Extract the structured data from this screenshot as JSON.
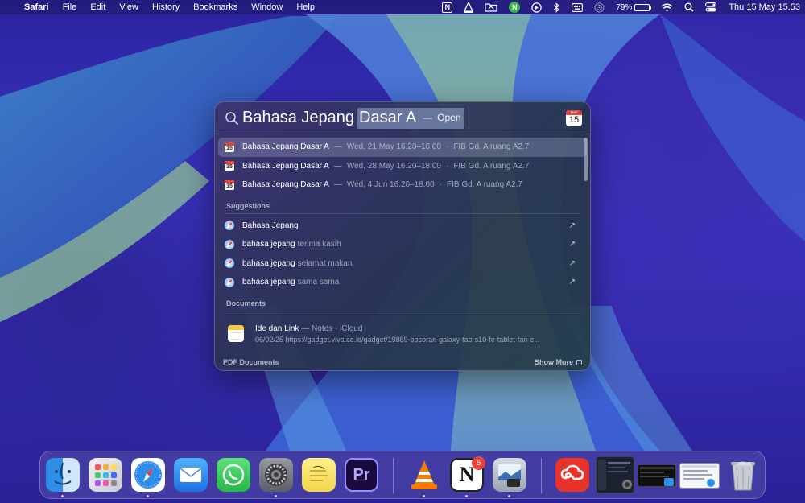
{
  "menubar": {
    "app_name": "Safari",
    "menus": [
      "File",
      "Edit",
      "View",
      "History",
      "Bookmarks",
      "Window",
      "Help"
    ],
    "status": {
      "notion_glyph": "N",
      "green_glyph": "N",
      "battery_percent": "79%",
      "battery_level": 0.79,
      "clock": "Thu 15 May  15.53"
    }
  },
  "spotlight": {
    "query_typed": "Bahasa Jepang",
    "query_completion": "Dasar A",
    "query_separator": "—",
    "query_action": "Open",
    "calendar_icon": {
      "month": "MAY",
      "day": "15"
    },
    "events": [
      {
        "title": "Bahasa Jepang Dasar A",
        "dash": "—",
        "when": "Wed, 21 May 16.20–18.00",
        "dot": "·",
        "where": "FIB Gd. A ruang A2.7",
        "day": "15"
      },
      {
        "title": "Bahasa Jepang Dasar A",
        "dash": "—",
        "when": "Wed, 28 May 16.20–18.00",
        "dot": "·",
        "where": "FIB Gd. A ruang A2.7",
        "day": "15"
      },
      {
        "title": "Bahasa Jepang Dasar A",
        "dash": "—",
        "when": "Wed, 4 Jun 16.20–18.00",
        "dot": "·",
        "where": "FIB Gd. A ruang A2.7",
        "day": "15"
      }
    ],
    "suggestions_header": "Suggestions",
    "suggestions": [
      {
        "bold": "Bahasa Jepang",
        "rest": ""
      },
      {
        "bold": "bahasa jepang",
        "rest": "terima kasih"
      },
      {
        "bold": "bahasa jepang",
        "rest": "selamat makan"
      },
      {
        "bold": "bahasa jepang",
        "rest": "sama sama"
      }
    ],
    "suggestion_arrow": "↗",
    "documents_header": "Documents",
    "document": {
      "title": "Ide dan Link",
      "meta": "— Notes · iCloud",
      "subtitle": "06/02/25 https://gadget.viva.co.id/gadget/19889-bocoran-galaxy-tab-s10-fe-tablet-fan-e..."
    },
    "pdf_header": "PDF Documents",
    "show_more": "Show More"
  },
  "dock": {
    "apps": [
      {
        "name": "Finder",
        "running": true
      },
      {
        "name": "Launchpad",
        "running": false
      },
      {
        "name": "Safari",
        "running": true
      },
      {
        "name": "Mail",
        "running": false
      },
      {
        "name": "WhatsApp",
        "running": false
      },
      {
        "name": "System Settings",
        "running": true
      },
      {
        "name": "Stickies",
        "running": false
      },
      {
        "name": "Premiere Pro",
        "running": false,
        "glyph": "Pr"
      },
      {
        "name": "VLC",
        "running": true
      },
      {
        "name": "Notion",
        "running": true,
        "glyph": "N",
        "badge": "6"
      },
      {
        "name": "Preview",
        "running": true
      },
      {
        "name": "Creative Cloud",
        "running": false
      },
      {
        "name": "Window 1",
        "running": false
      },
      {
        "name": "Window 2",
        "running": false
      },
      {
        "name": "Window 3",
        "running": false
      },
      {
        "name": "Trash",
        "running": false
      }
    ]
  },
  "colors": {
    "wallpaper_base": "#2b23a0",
    "wallpaper_stream": "#9ec98c",
    "calendar_red": "#e8413a",
    "battery_yellow": "#f5c518",
    "badge_red": "#e8413a"
  }
}
